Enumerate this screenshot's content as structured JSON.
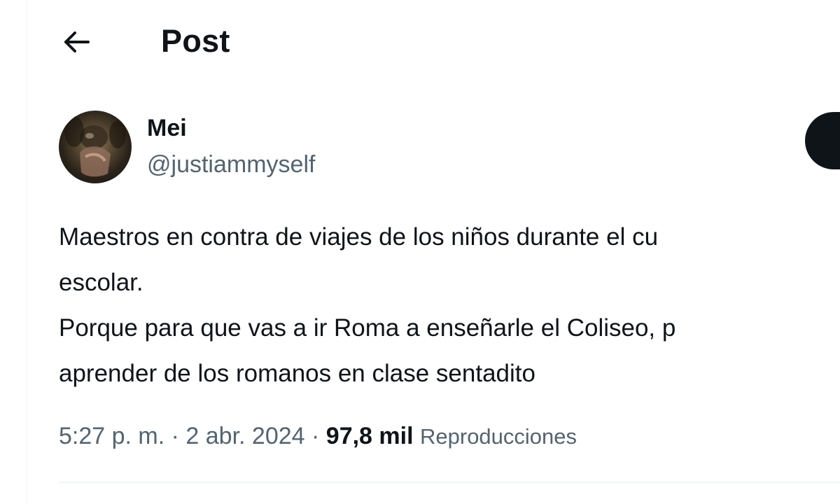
{
  "header": {
    "title": "Post",
    "back_icon": "arrow-left-icon"
  },
  "author": {
    "display_name": "Mei",
    "handle": "@justiammyself",
    "avatar_icon": "avatar-photo"
  },
  "post": {
    "lines": [
      "Maestros en contra de viajes de los niños durante el cu",
      "escolar.",
      "Porque para que vas a ir Roma a enseñarle el Coliseo, p",
      "aprender de los romanos en clase sentadito"
    ]
  },
  "meta": {
    "time": "5:27 p. m.",
    "separator1": " · ",
    "date": "2 abr. 2024",
    "separator2": " · ",
    "views_count": "97,8 mil",
    "views_label": "Reproducciones"
  },
  "colors": {
    "text_primary": "#0f1419",
    "text_secondary": "#536471",
    "divider": "#eff3f4",
    "follow_button_bg": "#0f1419"
  }
}
